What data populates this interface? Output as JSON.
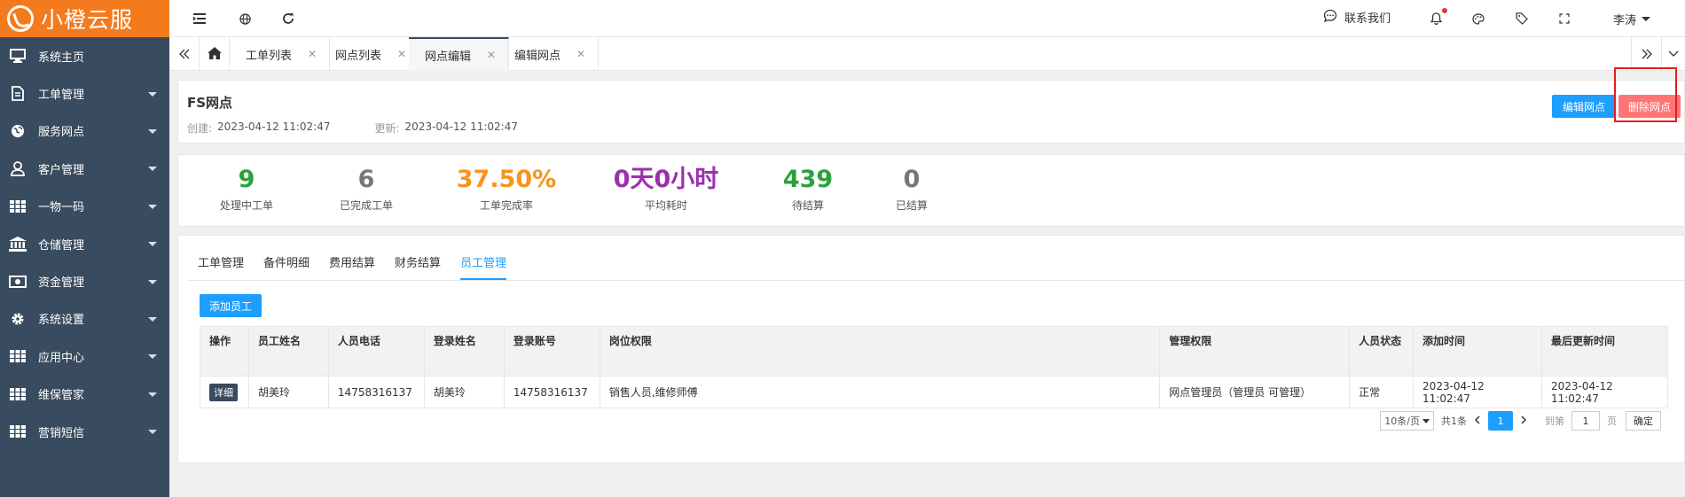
{
  "brand": {
    "name": "小橙云服",
    "color": "#f37b1d"
  },
  "sidebar": {
    "items": [
      {
        "label": "系统主页",
        "icon": "monitor-icon"
      },
      {
        "label": "工单管理",
        "icon": "document-icon"
      },
      {
        "label": "服务网点",
        "icon": "globe-icon"
      },
      {
        "label": "客户管理",
        "icon": "user-icon"
      },
      {
        "label": "一物一码",
        "icon": "grid-icon"
      },
      {
        "label": "仓储管理",
        "icon": "bank-icon"
      },
      {
        "label": "资金管理",
        "icon": "money-icon"
      },
      {
        "label": "系统设置",
        "icon": "gear-icon"
      },
      {
        "label": "应用中心",
        "icon": "grid-icon"
      },
      {
        "label": "维保管家",
        "icon": "grid-icon"
      },
      {
        "label": "营销短信",
        "icon": "grid-icon"
      }
    ]
  },
  "header": {
    "contact": "联系我们",
    "user": "李涛"
  },
  "tabs": [
    {
      "label": "工单列表"
    },
    {
      "label": "网点列表"
    },
    {
      "label": "网点编辑"
    },
    {
      "label": "编辑网点"
    }
  ],
  "outlet": {
    "name": "FS网点",
    "created_label": "创建:",
    "created": "2023-04-12 11:02:47",
    "updated_label": "更新:",
    "updated": "2023-04-12 11:02:47",
    "edit_button": "编辑网点",
    "delete_button": "删除网点"
  },
  "stats": [
    {
      "value": "9",
      "label": "处理中工单",
      "color": "#2aa13a"
    },
    {
      "value": "6",
      "label": "已完成工单",
      "color": "#777777"
    },
    {
      "value": "37.50%",
      "label": "工单完成率",
      "color": "#f7941d"
    },
    {
      "value": "0天0小时",
      "label": "平均耗时",
      "color": "#9b2fae"
    },
    {
      "value": "439",
      "label": "待结算",
      "color": "#2aa13a"
    },
    {
      "value": "0",
      "label": "已结算",
      "color": "#777777"
    }
  ],
  "sub_tabs": [
    "工单管理",
    "备件明细",
    "费用结算",
    "财务结算",
    "员工管理"
  ],
  "add_employee": "添加员工",
  "table": {
    "headers": [
      "操作",
      "员工姓名",
      "人员电话",
      "登录姓名",
      "登录账号",
      "岗位权限",
      "管理权限",
      "人员状态",
      "添加时间",
      "最后更新时间"
    ],
    "rows": [
      {
        "action": "详细",
        "name": "胡美玲",
        "phone": "14758316137",
        "login_name": "胡美玲",
        "account": "14758316137",
        "roles": "销售人员,维修师傅",
        "admin": "网点管理员（管理员 可管理）",
        "status": "正常",
        "added": "2023-04-12 11:02:47",
        "updated": "2023-04-12 11:02:47"
      }
    ]
  },
  "pager": {
    "page_size": "10条/页",
    "total": "共1条",
    "current": "1",
    "goto_label": "到第",
    "goto_value": "1",
    "page_unit": "页",
    "confirm": "确定"
  }
}
